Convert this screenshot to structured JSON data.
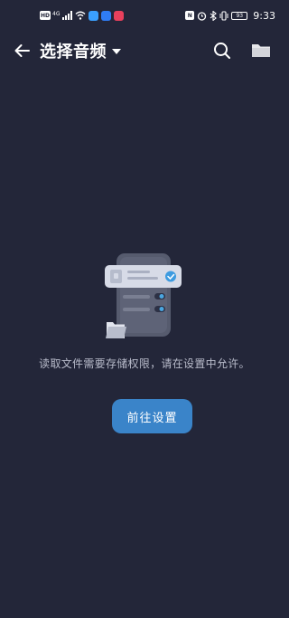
{
  "status_bar": {
    "network_left": "HD",
    "network_type": "4G",
    "time": "9:33",
    "battery": "93",
    "nfc": "N",
    "app_colors": [
      "#3aa0ff",
      "#2f7cf6",
      "#e8405c"
    ]
  },
  "app_bar": {
    "title": "选择音频",
    "back_icon": "arrow-left-icon",
    "dropdown_icon": "caret-down-icon",
    "search_icon": "search-icon",
    "folder_icon": "folder-icon"
  },
  "empty_state": {
    "illustration": "storage-permission-illustration",
    "message": "读取文件需要存储权限，请在设置中允许。",
    "button_label": "前往设置"
  },
  "colors": {
    "background": "#232639",
    "accent": "#3a84c9",
    "message_text": "#b9bccb"
  }
}
